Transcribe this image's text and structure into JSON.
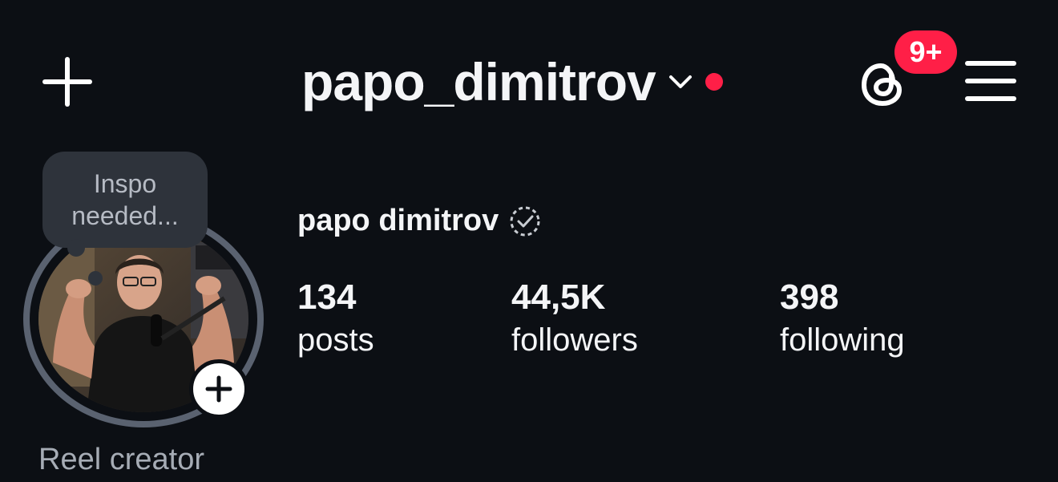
{
  "header": {
    "username": "papo_dimitrov",
    "notification_badge": "9+",
    "icons": [
      "plus-icon",
      "chevron-down-icon",
      "threads-icon",
      "menu-icon"
    ],
    "accent_color": "#ff1f47"
  },
  "note": {
    "text_line1": "Inspo",
    "text_line2": "needed..."
  },
  "profile": {
    "display_name": "papo dimitrov",
    "category": "Reel creator"
  },
  "stats": {
    "posts": {
      "value": "134",
      "label": "posts"
    },
    "followers": {
      "value": "44,5K",
      "label": "followers"
    },
    "following": {
      "value": "398",
      "label": "following"
    }
  }
}
